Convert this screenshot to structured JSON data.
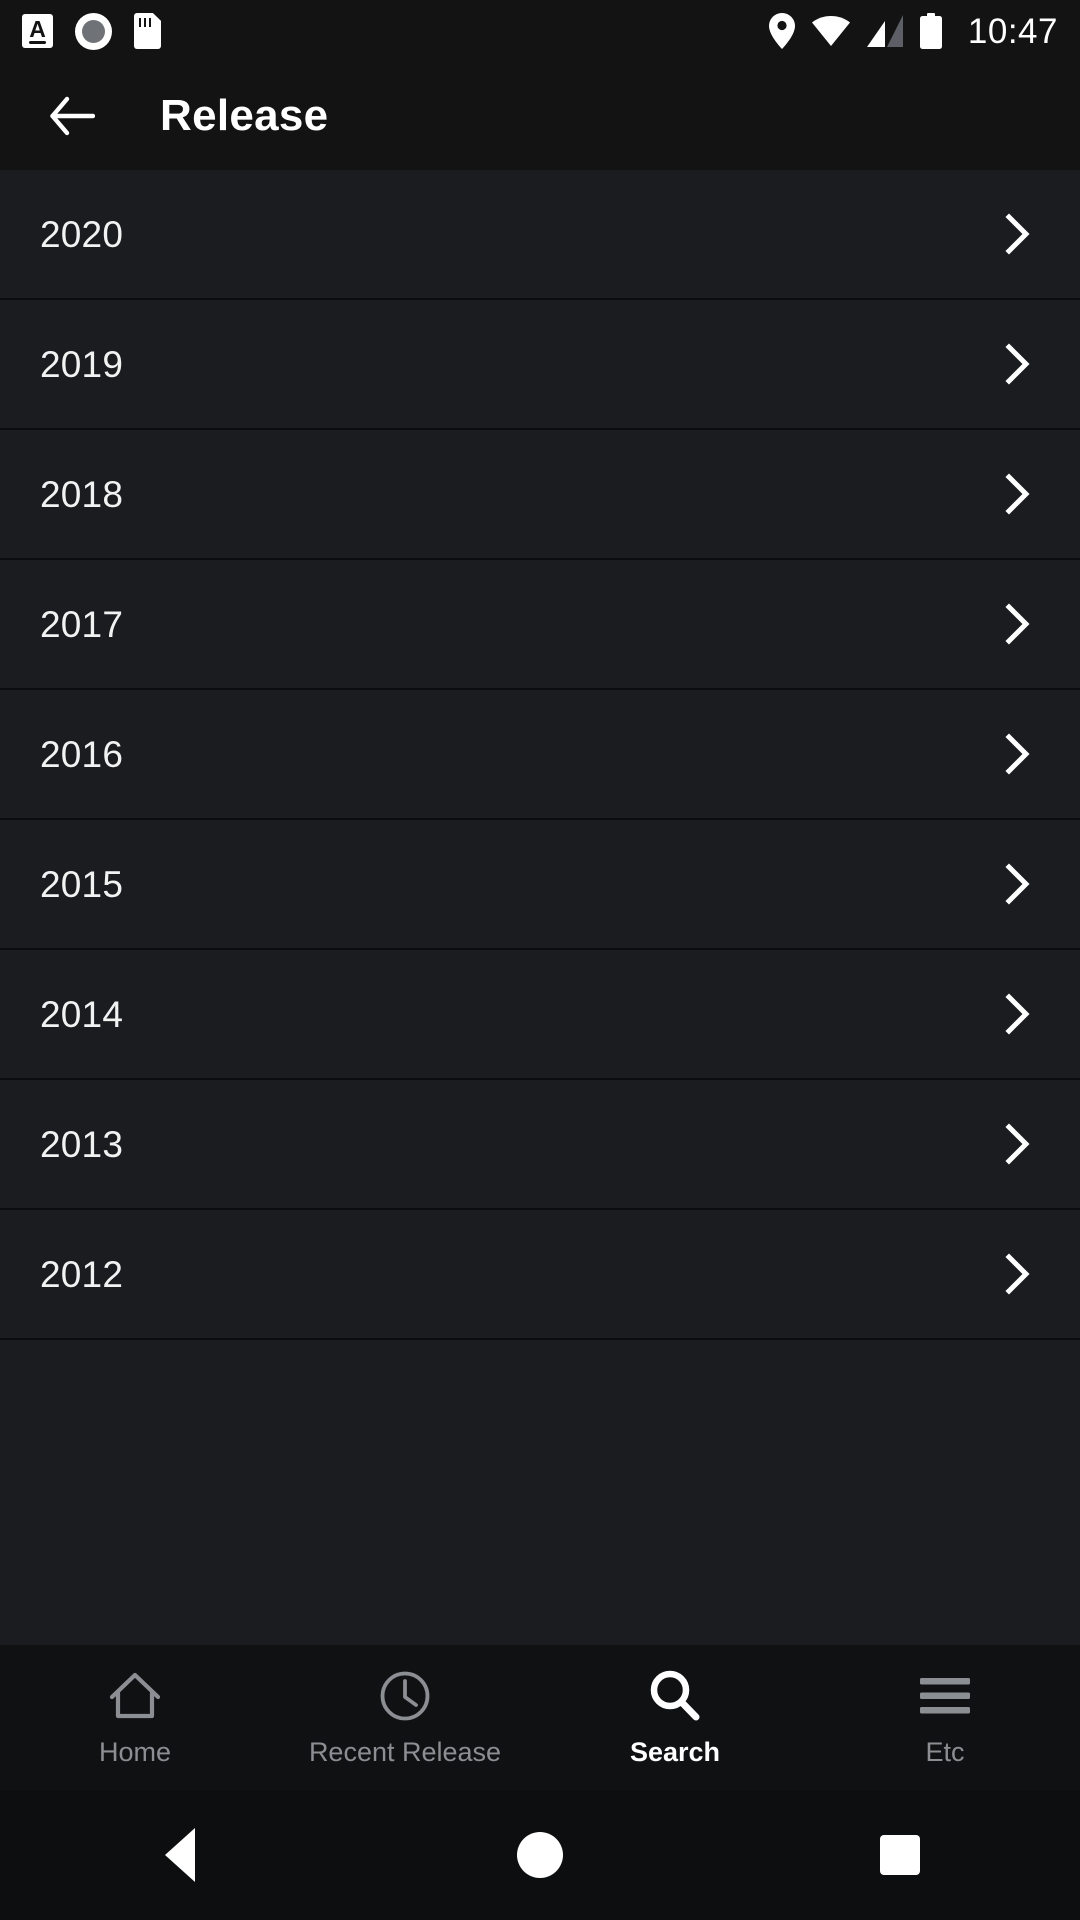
{
  "statusbar": {
    "time": "10:47",
    "icons_left": [
      {
        "name": "caps-lock-icon",
        "glyph": "A"
      },
      {
        "name": "screen-record-icon",
        "glyph": "record"
      },
      {
        "name": "sd-card-icon",
        "glyph": "sdcard"
      }
    ],
    "icons_right": [
      {
        "name": "location-icon"
      },
      {
        "name": "wifi-icon"
      },
      {
        "name": "cellular-signal-icon"
      },
      {
        "name": "battery-icon"
      }
    ]
  },
  "toolbar": {
    "back_icon": "arrow-left-icon",
    "title": "Release"
  },
  "list": {
    "items": [
      {
        "label": "2020",
        "chevron": "chevron-right-icon"
      },
      {
        "label": "2019",
        "chevron": "chevron-right-icon"
      },
      {
        "label": "2018",
        "chevron": "chevron-right-icon"
      },
      {
        "label": "2017",
        "chevron": "chevron-right-icon"
      },
      {
        "label": "2016",
        "chevron": "chevron-right-icon"
      },
      {
        "label": "2015",
        "chevron": "chevron-right-icon"
      },
      {
        "label": "2014",
        "chevron": "chevron-right-icon"
      },
      {
        "label": "2013",
        "chevron": "chevron-right-icon"
      },
      {
        "label": "2012",
        "chevron": "chevron-right-icon"
      }
    ]
  },
  "bottom_nav": {
    "tabs": [
      {
        "label": "Home",
        "icon": "home-icon",
        "active": false
      },
      {
        "label": "Recent Release",
        "icon": "clock-icon",
        "active": false
      },
      {
        "label": "Search",
        "icon": "search-icon",
        "active": true
      },
      {
        "label": "Etc",
        "icon": "hamburger-menu-icon",
        "active": false
      }
    ]
  },
  "system_nav": {
    "buttons": [
      {
        "name": "android-back-button"
      },
      {
        "name": "android-home-button"
      },
      {
        "name": "android-recents-button"
      }
    ]
  },
  "colors": {
    "background": "#1a1c1f",
    "toolbar": "#131313",
    "divider": "#0b0c0d",
    "text_primary": "#f2f2f2",
    "text_inactive": "#8b8e92",
    "accent_active": "#ffffff"
  }
}
